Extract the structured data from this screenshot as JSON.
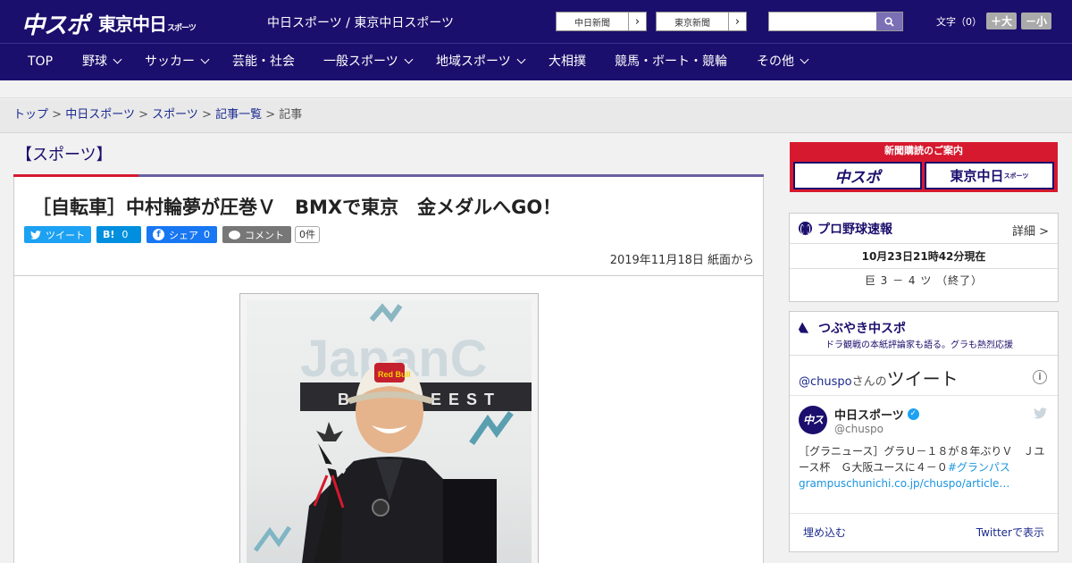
{
  "header": {
    "logo_main": "中スポ",
    "logo_tokyo": "東京中日",
    "logo_tokyo_small": "スポーツ",
    "site_name": "中日スポーツ / 東京中日スポーツ",
    "paper_links": [
      "中日新聞",
      "東京新聞"
    ],
    "search": {
      "placeholder": "",
      "value": ""
    },
    "font_size": {
      "label": "文字（0）",
      "bigger": "＋大",
      "smaller": "－小"
    }
  },
  "nav": {
    "items": [
      {
        "label": "TOP",
        "has_dropdown": false
      },
      {
        "label": "野球",
        "has_dropdown": true
      },
      {
        "label": "サッカー",
        "has_dropdown": true
      },
      {
        "label": "芸能・社会",
        "has_dropdown": false
      },
      {
        "label": "一般スポーツ",
        "has_dropdown": true
      },
      {
        "label": "地域スポーツ",
        "has_dropdown": true
      },
      {
        "label": "大相撲",
        "has_dropdown": false
      },
      {
        "label": "競馬・ボート・競輪",
        "has_dropdown": false
      },
      {
        "label": "その他",
        "has_dropdown": true
      }
    ]
  },
  "breadcrumb": {
    "items": [
      "トップ",
      "中日スポーツ",
      "スポーツ",
      "記事一覧"
    ],
    "current": "記事",
    "separator": ">"
  },
  "section_title": "【スポーツ】",
  "article": {
    "title": "［自転車］中村輪夢が圧巻Ｖ　BMXで東京　金メダルへGO！",
    "share": {
      "tweet": "ツイート",
      "hatena_label": "B!",
      "hatena_count": "0",
      "facebook": "シェア",
      "facebook_count": "0",
      "comment": "コメント",
      "comment_count": "0件"
    },
    "date": "2019年11月18日 紙面から",
    "photo_description": "Smiling BMX rider in a Red Bull cap holding a trophy in front of a Japan Cup BMX Freestyle backdrop"
  },
  "sidebar": {
    "subscribe": {
      "header": "新聞購読のご案内",
      "left": "中スポ",
      "right": "東京中日",
      "right_small": "スポーツ"
    },
    "pro_baseball": {
      "title": "プロ野球速報",
      "more": "詳細 >",
      "time": "10月23日21時42分現在",
      "game": "巨 3 － 4 ツ （終了）"
    },
    "tweets": {
      "title": "つぶやき中スポ",
      "subtitle": "ドラ観戦の本紙評論家も語る。グラも熱烈応援",
      "account_prefix": "@chuspo",
      "account_suffix": "さんの",
      "heading": "ツイート",
      "tweet": {
        "name": "中日スポーツ",
        "handle": "@chuspo",
        "avatar": "中スポ",
        "text": "［グラニュース］グラＵ－１８が８年ぶりＶ　Ｊユース杯　Ｇ大阪ユースに４－０",
        "hashtag": "#グランパス",
        "link": "grampuschunichi.co.jp/chuspo/article…"
      },
      "embed": "埋め込む",
      "view_on": "Twitterで表示"
    }
  },
  "colors": {
    "brand_navy": "#1b0f6d",
    "accent_red": "#d6192e",
    "twitter": "#1da1f2",
    "facebook": "#1877f2"
  }
}
